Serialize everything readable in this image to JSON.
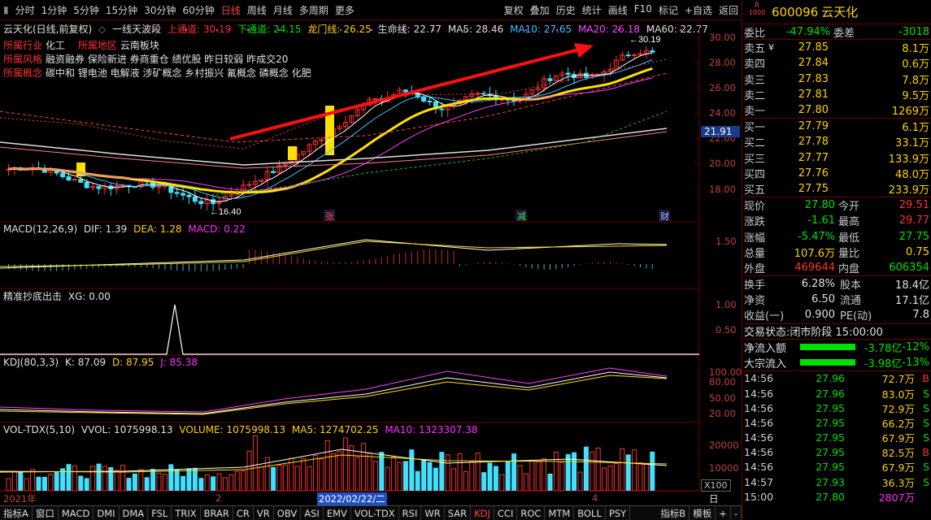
{
  "toolbar": {
    "left": [
      "分时",
      "1分钟",
      "5分钟",
      "15分钟",
      "30分钟",
      "60分钟",
      "日线",
      "周线",
      "月线",
      "多周期",
      "更多"
    ],
    "right": [
      "复权",
      "叠加",
      "历史",
      "统计",
      "画线",
      "F10",
      "标记",
      "+自选",
      "返回"
    ]
  },
  "main_overlay": {
    "stock_name": "云天化(日线,前复权)",
    "indicator": "一线天波段",
    "up_channel_label": "上通道:",
    "up_channel": "30.19",
    "down_channel_label": "下通道:",
    "down_channel": "24.15",
    "dragon_label": "龙门线:",
    "dragon": "26.25",
    "life_label": "生命线:",
    "life": "22.77",
    "ma5": "MA5: 28.46",
    "ma10": "MA10: 27.65",
    "ma20": "MA20: 26.18",
    "ma60": "MA60: 22.77",
    "industry_label": "所属行业",
    "industry": "化工",
    "region_label": "所属地区",
    "region": "云南板块",
    "style_label": "所属风格",
    "style": "融资融券 保险新进 券商重仓 绩优股 昨日较弱 昨成交20",
    "concept_label": "所属概念",
    "concept": "碳中和 锂电池 电解液 涉矿概念 乡村振兴 氟概念 磷概念 化肥",
    "high_mark": "30.19",
    "low_mark": "16.40",
    "badges": [
      "张",
      "减",
      "财"
    ],
    "last_price_tag": "21.91"
  },
  "macd": {
    "title": "MACD(12,26,9)",
    "dif": "DIF: 1.39",
    "dea": "DEA: 1.28",
    "macd": "MACD: 0.22",
    "axis": [
      "1.50"
    ]
  },
  "jzcd": {
    "title": "精准抄底出击",
    "xg": "XG: 0.00",
    "axis": [
      "1.00",
      "0.50"
    ]
  },
  "kdj": {
    "title": "KDJ(80,3,3)",
    "k": "K: 87.09",
    "d": "D: 87.95",
    "j": "J: 85.38",
    "axis": [
      "100.00",
      "80.00",
      "50.00",
      "20.00"
    ]
  },
  "vol": {
    "title": "VOL-TDX(5,10)",
    "vvol": "VVOL: 1075998.13",
    "volume": "VOLUME: 1075998.13",
    "ma5": "MA5: 1274702.25",
    "ma10": "MA10: 1323307.38",
    "axis": [
      "20000",
      "10000"
    ],
    "unit": "X100"
  },
  "price_axis": [
    "30.00",
    "28.00",
    "26.00",
    "24.00",
    "22.00",
    "20.00",
    "18.00"
  ],
  "dates": {
    "y2021": "2021年",
    "m2": "2",
    "cursor": "2022/02/22/二",
    "m4": "4",
    "period": "日线"
  },
  "bottom_tabs": [
    "指标A",
    "窗口",
    "MACD",
    "DMI",
    "DMA",
    "FSL",
    "TRIX",
    "BRAR",
    "CR",
    "VR",
    "OBV",
    "ASI",
    "EMV",
    "VOL-TDX",
    "RSI",
    "WR",
    "SAR",
    "KDJ",
    "CCI",
    "ROC",
    "MTM",
    "BOLL",
    "PSY"
  ],
  "bottom_right": [
    "指标B",
    "模板",
    "+",
    "-"
  ],
  "quote": {
    "code": "600096",
    "name": "云天化",
    "logo": "R\n1000",
    "weibi_label": "委比",
    "weibi": "-47.94%",
    "weicha_label": "委差",
    "weicha": "-3018",
    "asks": [
      {
        "label": "卖五",
        "flag": "¥",
        "price": "27.85",
        "vol": "8.1万"
      },
      {
        "label": "卖四",
        "flag": "",
        "price": "27.84",
        "vol": "0.6万"
      },
      {
        "label": "卖三",
        "flag": "",
        "price": "27.83",
        "vol": "7.8万"
      },
      {
        "label": "卖二",
        "flag": "",
        "price": "27.81",
        "vol": "9.5万"
      },
      {
        "label": "卖一",
        "flag": "",
        "price": "27.80",
        "vol": "1269万"
      }
    ],
    "bids": [
      {
        "label": "买一",
        "price": "27.79",
        "vol": "6.1万"
      },
      {
        "label": "买二",
        "price": "27.78",
        "vol": "33.1万"
      },
      {
        "label": "买三",
        "price": "27.77",
        "vol": "133.9万"
      },
      {
        "label": "买四",
        "price": "27.76",
        "vol": "48.0万"
      },
      {
        "label": "买五",
        "price": "27.75",
        "vol": "233.9万"
      }
    ],
    "stats": [
      {
        "l1": "现价",
        "v1": "27.80",
        "c1": "grn",
        "l2": "今开",
        "v2": "29.51",
        "c2": "red"
      },
      {
        "l1": "涨跌",
        "v1": "-1.61",
        "c1": "grn",
        "l2": "最高",
        "v2": "29.77",
        "c2": "red"
      },
      {
        "l1": "涨幅",
        "v1": "-5.47%",
        "c1": "grn",
        "l2": "最低",
        "v2": "27.75",
        "c2": "grn"
      },
      {
        "l1": "总量",
        "v1": "107.6万",
        "c1": "yel",
        "l2": "量比",
        "v2": "0.75",
        "c2": "yel"
      },
      {
        "l1": "外盘",
        "v1": "469644",
        "c1": "red",
        "l2": "内盘",
        "v2": "606354",
        "c2": "grn"
      }
    ],
    "stats2": [
      {
        "l1": "换手",
        "v1": "6.28%",
        "l2": "股本",
        "v2": "18.4亿"
      },
      {
        "l1": "净资",
        "v1": "6.50",
        "l2": "流通",
        "v2": "17.1亿"
      },
      {
        "l1": "收益(一)",
        "v1": "0.900",
        "l2": "PE(动)",
        "v2": "7.8"
      }
    ],
    "trade_status_label": "交易状态:",
    "trade_status": "闭市阶段 15:00:00",
    "flows": [
      {
        "label": "净流入额",
        "val": "-3.78亿",
        "pct": "-12%"
      },
      {
        "label": "大宗流入",
        "val": "-3.98亿",
        "pct": "-13%"
      }
    ],
    "ticks": [
      {
        "t": "14:56",
        "p": "27.96",
        "v": "72.7万",
        "bs": "B"
      },
      {
        "t": "14:56",
        "p": "27.96",
        "v": "83.0万",
        "bs": "S"
      },
      {
        "t": "14:56",
        "p": "27.95",
        "v": "72.9万",
        "bs": "S"
      },
      {
        "t": "14:56",
        "p": "27.95",
        "v": "66.2万",
        "bs": "S"
      },
      {
        "t": "14:56",
        "p": "27.95",
        "v": "67.9万",
        "bs": "S"
      },
      {
        "t": "14:56",
        "p": "27.95",
        "v": "82.5万",
        "bs": "B"
      },
      {
        "t": "14:56",
        "p": "27.95",
        "v": "67.9万",
        "bs": "S"
      },
      {
        "t": "14:57",
        "p": "27.93",
        "v": "36.3万",
        "bs": "S"
      },
      {
        "t": "15:00",
        "p": "27.80",
        "v": "2807万",
        "bs": ""
      }
    ]
  }
}
